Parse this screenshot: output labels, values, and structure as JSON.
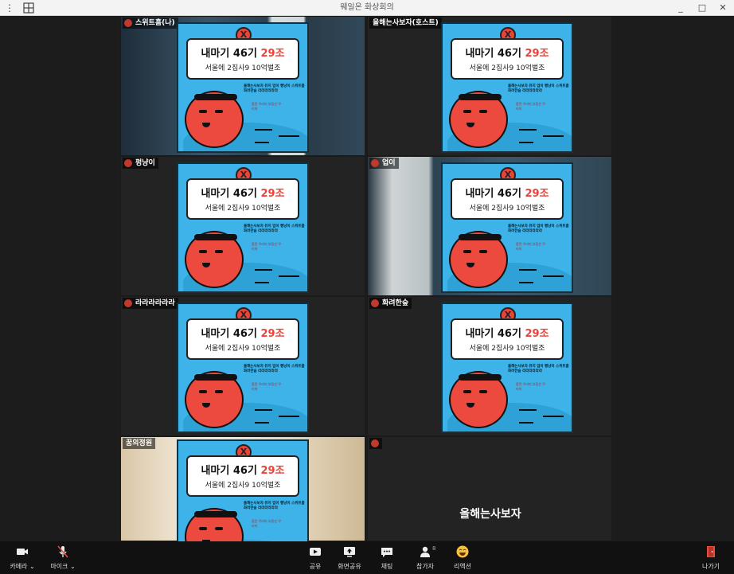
{
  "window": {
    "title": "웨일온 화상회의",
    "menu_icon": "⋮",
    "minimize": "_",
    "maximize": "□",
    "close": "✕"
  },
  "poster": {
    "x_mark": "X",
    "line1_a": "내마기 46기 ",
    "line1_b": "29조",
    "line2": "서울에 2집사9 10억벌조",
    "desc": "올해는사보자 뮤지 업이 빵냥이 스위트홈 화려한숲 라라라라라라",
    "small": "잠깐 꾸리미 부동산 꾸리미"
  },
  "participants": [
    {
      "name": "스위트홈(나)",
      "bg": "room1"
    },
    {
      "name": "올해는사보자(호스트)",
      "bg": "dark"
    },
    {
      "name": "펑냥이",
      "bg": "dark"
    },
    {
      "name": "업이",
      "bg": "room2"
    },
    {
      "name": "라라라라라라",
      "bg": "dark"
    },
    {
      "name": "화려한숲",
      "bg": "dark"
    },
    {
      "name": "꿈의정원",
      "bg": "wood"
    },
    {
      "name": "",
      "bg": "dark"
    }
  ],
  "empty_tile_name": "올해는사보자",
  "toolbar": {
    "camera": "카메라 ⌄",
    "mic": "마이크 ⌄",
    "share": "공유",
    "screen_share": "화면공유",
    "chat": "채팅",
    "participants": "참가자",
    "participants_count": "8",
    "reaction": "리액션",
    "leave": "나가기"
  },
  "colors": {
    "poster_blue": "#3db3ea",
    "accent_red": "#e8443a",
    "leave_red": "#e74c3c"
  }
}
